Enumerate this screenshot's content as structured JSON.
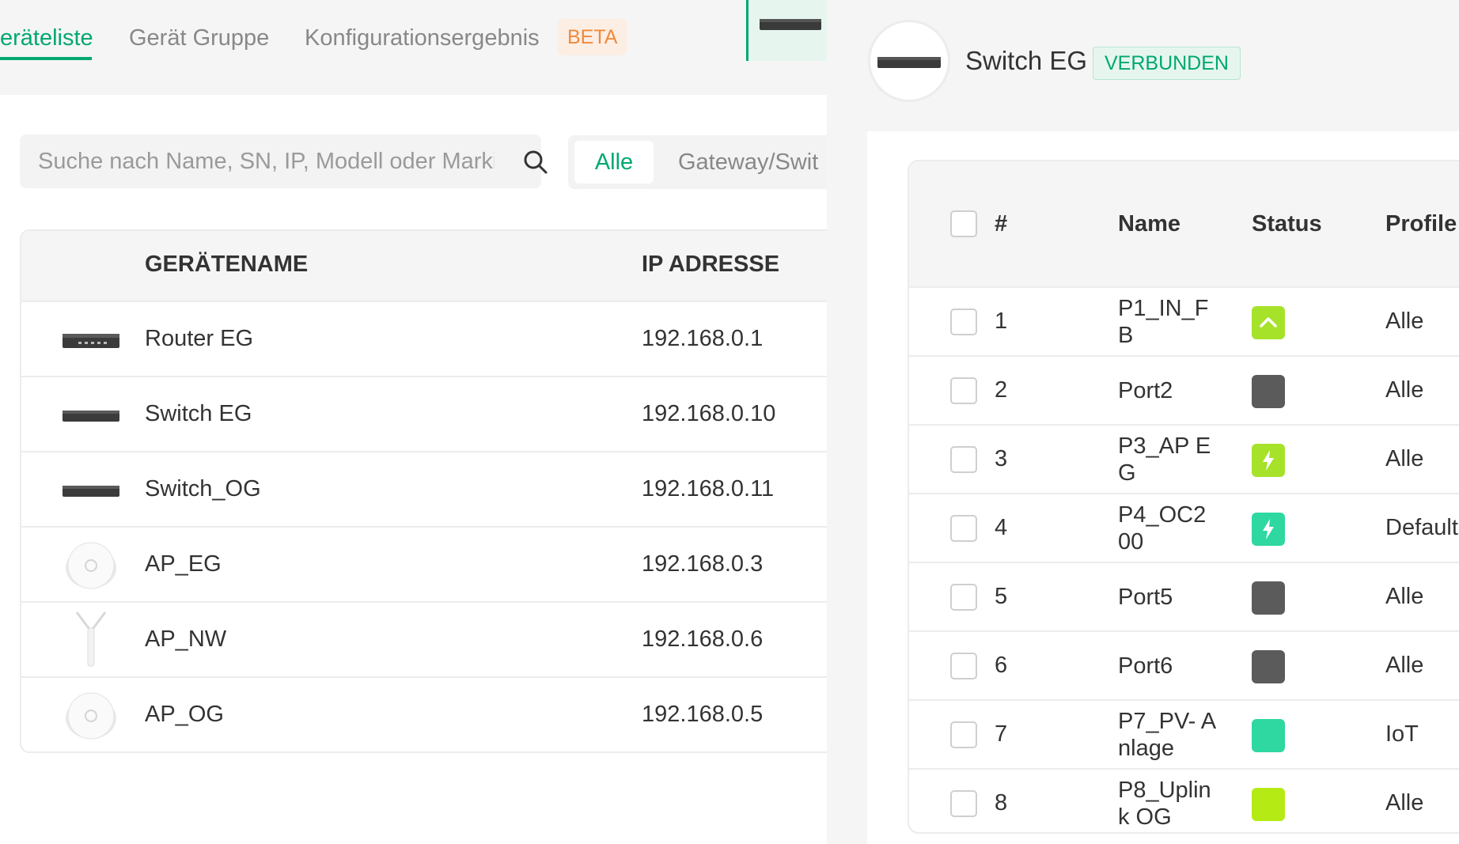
{
  "tabs": [
    {
      "label": "eräteliste"
    },
    {
      "label": "Gerät Gruppe"
    },
    {
      "label": "Konfigurationsergebnis"
    }
  ],
  "beta_badge": "BETA",
  "search": {
    "placeholder": "Suche nach Name, SN, IP, Modell oder Marki"
  },
  "filter": {
    "all": "Alle",
    "gateway": "Gateway/Swit"
  },
  "device_table": {
    "headers": {
      "name": "GERÄTENAME",
      "ip": "IP ADRESSE"
    },
    "rows": [
      {
        "name": "Router EG",
        "ip": "192.168.0.1",
        "type": "router-icon"
      },
      {
        "name": "Switch EG",
        "ip": "192.168.0.10",
        "type": "switch-icon"
      },
      {
        "name": "Switch_OG",
        "ip": "192.168.0.11",
        "type": "switch-icon"
      },
      {
        "name": "AP_EG",
        "ip": "192.168.0.3",
        "type": "ceiling-ap-icon"
      },
      {
        "name": "AP_NW",
        "ip": "192.168.0.6",
        "type": "outdoor-ap-icon"
      },
      {
        "name": "AP_OG",
        "ip": "192.168.0.5",
        "type": "ceiling-ap-icon"
      }
    ]
  },
  "drawer": {
    "title": "Switch EG",
    "status": "VERBUNDEN",
    "port_table": {
      "headers": {
        "num": "#",
        "name": "Name",
        "status": "Status",
        "profile": "Profile"
      },
      "rows": [
        {
          "num": "1",
          "name": "P1_IN_F B",
          "status": "uplink",
          "status_color": "#a6e22a",
          "profile": "Alle"
        },
        {
          "num": "2",
          "name": "Port2",
          "status": "down",
          "status_color": "#5b5b5b",
          "profile": "Alle"
        },
        {
          "num": "3",
          "name": "P3_AP EG",
          "status": "poe",
          "status_color": "#a6e22a",
          "profile": "Alle"
        },
        {
          "num": "4",
          "name": "P4_OC2 00",
          "status": "poe",
          "status_color": "#2fd8a0",
          "profile": "Default"
        },
        {
          "num": "5",
          "name": "Port5",
          "status": "down",
          "status_color": "#5b5b5b",
          "profile": "Alle"
        },
        {
          "num": "6",
          "name": "Port6",
          "status": "down",
          "status_color": "#5b5b5b",
          "profile": "Alle"
        },
        {
          "num": "7",
          "name": "P7_PV- Anlage",
          "status": "up",
          "status_color": "#2fd8a0",
          "profile": "IoT"
        },
        {
          "num": "8",
          "name": "P8_Uplin k OG",
          "status": "up",
          "status_color": "#b6ea14",
          "profile": "Alle"
        }
      ]
    }
  },
  "colors": {
    "accent": "#00a870",
    "beta": "#f08a3c"
  }
}
